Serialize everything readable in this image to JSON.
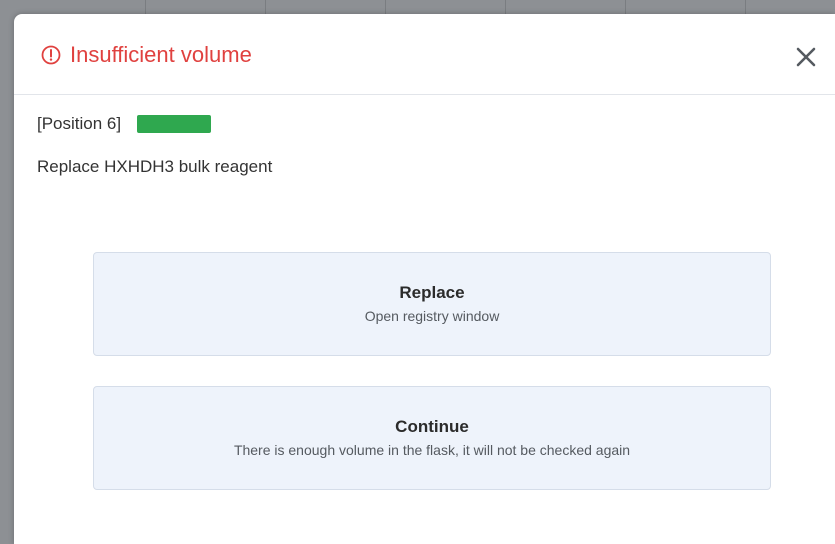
{
  "dialog": {
    "title": "Insufficient volume",
    "alert_icon": "alert-circle-icon",
    "close_icon": "close-icon",
    "title_color": "#e0413f"
  },
  "content": {
    "position_label": "[Position 6]",
    "status_color": "#2fa84f",
    "message": "Replace HXHDH3 bulk reagent"
  },
  "actions": {
    "replace": {
      "title": "Replace",
      "description": "Open registry window"
    },
    "continue": {
      "title": "Continue",
      "description": "There is enough volume in the flask, it will not be checked again"
    }
  }
}
